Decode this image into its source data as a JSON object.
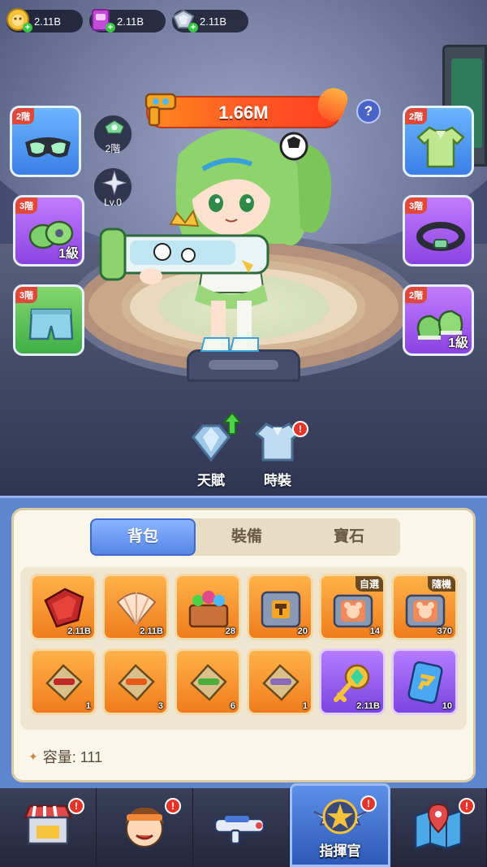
{
  "resources": [
    {
      "name": "gold",
      "value": "2.11B",
      "color": "#f4c23b"
    },
    {
      "name": "book",
      "value": "2.11B",
      "color": "#c24bd8"
    },
    {
      "name": "armor-shard",
      "value": "2.11B",
      "color": "#b6c3d6"
    }
  ],
  "power": {
    "value": "1.66M",
    "help": "?"
  },
  "slots": {
    "goggles": {
      "tier": "2階"
    },
    "shirt": {
      "tier": "2階"
    },
    "gloves": {
      "tier": "3階",
      "level": "1級"
    },
    "belt": {
      "tier": "3階"
    },
    "shorts": {
      "tier": "3階"
    },
    "shoes": {
      "tier": "2階",
      "level": "1級"
    }
  },
  "rank_badge": {
    "label": "2階"
  },
  "level_badge": {
    "label": "Lv.0"
  },
  "actions": {
    "talent": "天賦",
    "costume": "時裝",
    "costume_badge": "!"
  },
  "bag": {
    "tabs": [
      "背包",
      "裝備",
      "寶石"
    ],
    "active_tab": 0,
    "items_row1": [
      {
        "icon": "red-fabric-icon",
        "count": "2.11B"
      },
      {
        "icon": "shell-icon",
        "count": "2.11B"
      },
      {
        "icon": "gem-chest-icon",
        "count": "28"
      },
      {
        "icon": "hammer-box-icon",
        "count": "20"
      },
      {
        "icon": "bear-box-icon",
        "count": "14",
        "corner": "自選"
      },
      {
        "icon": "bear-box-icon",
        "count": "370",
        "corner": "隨機"
      }
    ],
    "items_row2": [
      {
        "icon": "gun-puzzle-icon",
        "count": "1"
      },
      {
        "icon": "gun-puzzle-icon",
        "count": "3"
      },
      {
        "icon": "gun-puzzle-icon",
        "count": "6"
      },
      {
        "icon": "gun-puzzle-icon",
        "count": "1"
      },
      {
        "icon": "emerald-key-icon",
        "count": "2.11B"
      },
      {
        "icon": "card-icon",
        "count": "10"
      }
    ],
    "capacity": "容量: 111"
  },
  "nav": {
    "shop_badge": "!",
    "hero_badge": "!",
    "commander_label": "指揮官",
    "commander_badge": "!",
    "map_badge": "!"
  }
}
